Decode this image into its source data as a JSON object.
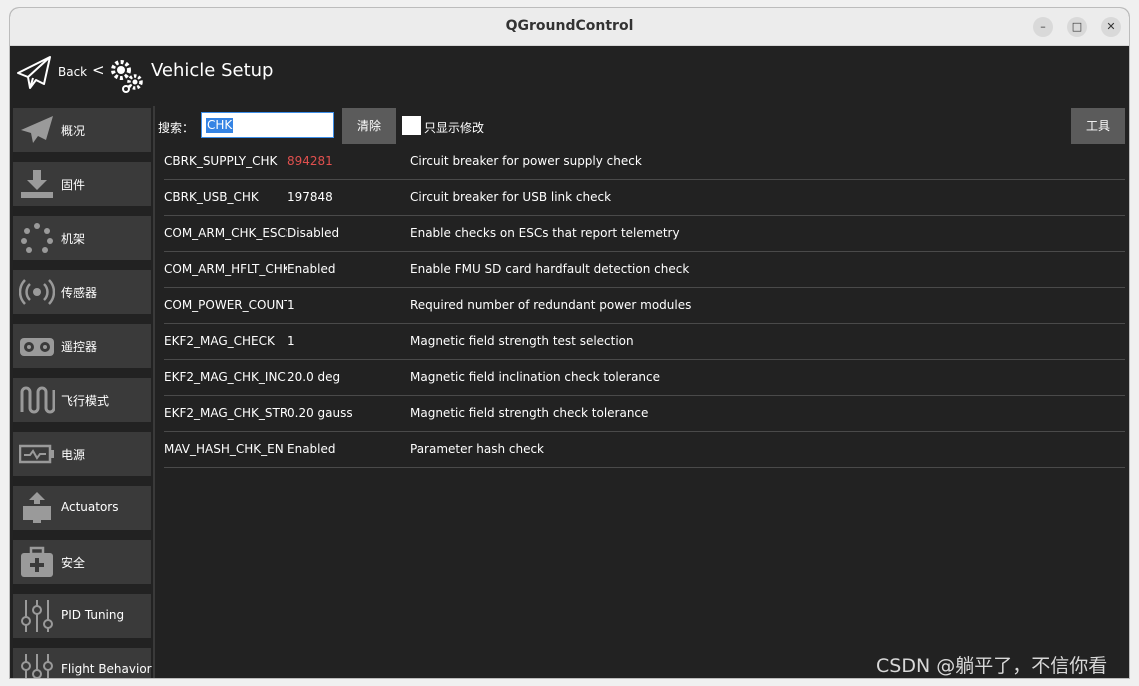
{
  "window": {
    "title": "QGroundControl"
  },
  "window_controls": {
    "minimize": "–",
    "maximize": "□",
    "close": "✕"
  },
  "header": {
    "back_label": "Back",
    "separator": "<",
    "title": "Vehicle Setup"
  },
  "sidebar": {
    "items": [
      {
        "label": "概况",
        "icon": "paper-plane-icon"
      },
      {
        "label": "固件",
        "icon": "download-icon"
      },
      {
        "label": "机架",
        "icon": "airframe-icon"
      },
      {
        "label": "传感器",
        "icon": "sensor-icon"
      },
      {
        "label": "遥控器",
        "icon": "radio-icon"
      },
      {
        "label": "飞行模式",
        "icon": "flight-mode-icon"
      },
      {
        "label": "电源",
        "icon": "battery-icon"
      },
      {
        "label": "Actuators",
        "icon": "actuator-icon"
      },
      {
        "label": "安全",
        "icon": "safety-icon"
      },
      {
        "label": "PID Tuning",
        "icon": "sliders-icon"
      },
      {
        "label": "Flight Behavior",
        "icon": "sliders-icon"
      }
    ]
  },
  "search": {
    "label": "搜索：",
    "value": "CHK",
    "clear_label": "清除",
    "only_modified_label": "只显示修改",
    "tools_label": "工具"
  },
  "params": [
    {
      "name": "CBRK_SUPPLY_CHK",
      "value": "894281",
      "changed": true,
      "desc": "Circuit breaker for power supply check"
    },
    {
      "name": "CBRK_USB_CHK",
      "value": "197848",
      "changed": false,
      "desc": "Circuit breaker for USB link check"
    },
    {
      "name": "COM_ARM_CHK_ESCS",
      "value": "Disabled",
      "changed": false,
      "desc": "Enable checks on ESCs that report telemetry"
    },
    {
      "name": "COM_ARM_HFLT_CHK",
      "value": "Enabled",
      "changed": false,
      "desc": "Enable FMU SD card hardfault detection check"
    },
    {
      "name": "COM_POWER_COUNT",
      "value": "1",
      "changed": false,
      "desc": "Required number of redundant power modules"
    },
    {
      "name": "EKF2_MAG_CHECK",
      "value": "1",
      "changed": false,
      "desc": "Magnetic field strength test selection"
    },
    {
      "name": "EKF2_MAG_CHK_INC",
      "value": "20.0 deg",
      "changed": false,
      "desc": "Magnetic field inclination check tolerance"
    },
    {
      "name": "EKF2_MAG_CHK_STR",
      "value": "0.20 gauss",
      "changed": false,
      "desc": "Magnetic field strength check tolerance"
    },
    {
      "name": "MAV_HASH_CHK_EN",
      "value": "Enabled",
      "changed": false,
      "desc": "Parameter hash check"
    }
  ],
  "colors": {
    "background": "#222222",
    "changed_value": "#e0504e",
    "selection": "#3584e4",
    "button": "#5b5b5b"
  },
  "watermark": "CSDN @躺平了，不信你看"
}
